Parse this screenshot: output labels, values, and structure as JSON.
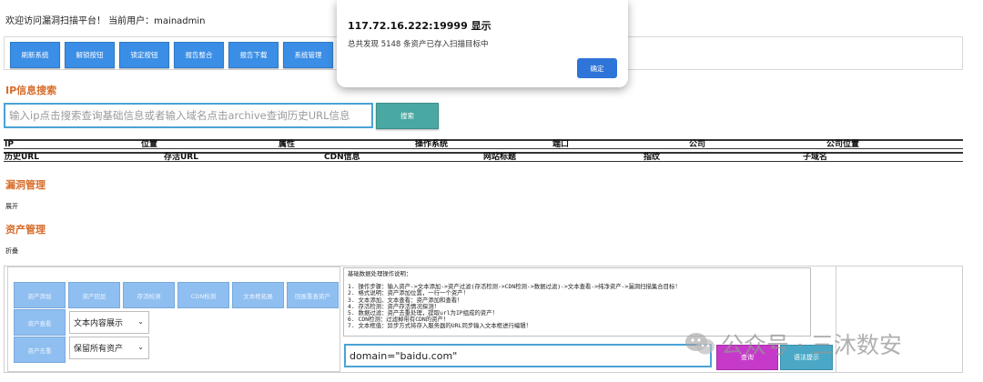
{
  "header": {
    "welcome": "欢迎访问漏洞扫描平台！ 当前用户：mainadmin"
  },
  "toolbar": {
    "buttons": [
      "刷新系统",
      "解锁按钮",
      "锁定按钮",
      "报告整合",
      "报告下载",
      "系统管理"
    ]
  },
  "ip_search": {
    "title": "IP信息搜索",
    "placeholder": "输入ip点击搜索查询基础信息或者输入域名点击archive查询历史URL信息",
    "button": "搜索"
  },
  "table": {
    "row1": [
      "IP",
      "位置",
      "属性",
      "操作系统",
      "端口",
      "公司",
      "公司位置"
    ],
    "row2": [
      "历史URL",
      "存活URL",
      "CDN信息",
      "网站标题",
      "指纹",
      "子域名"
    ]
  },
  "vuln": {
    "title": "漏洞管理",
    "toggle": "展开"
  },
  "asset": {
    "title": "资产管理",
    "toggle": "折叠",
    "buttons_row1": [
      "资产添加",
      "资产回显",
      "存活检测",
      "CDN检测",
      "文本框拓展",
      "回报重查资产"
    ],
    "view_label": "资产查看",
    "view_select": "文本内容展示",
    "dedup_label": "资产去重",
    "dedup_select": "保留所有资产",
    "desc_title": "基础数据处理操作说明：",
    "desc_lines": [
      "1. 操作步骤：输入资产->文本添加->资产过滤(存活检测->CDN检测->数据过滤)->文本查看->纯净资产->漏洞扫描集合目标！",
      "2. 格式说明：资产添加位置，一行一个资产！",
      "3. 文本添加、文本查看：资产添加和查看！",
      "4. 存活检测：资产存活情况探测！",
      "5. 数据过滤：资产去重处理，提取url为IP组成的资产！",
      "6. CDN检测：过滤掉带有CDN的资产！",
      "7. 文本框值：异步方式将存入服务器的URL同步输入文本框进行编辑！"
    ],
    "domain_value": "domain=\"baidu.com\"",
    "query_button": "查询",
    "syntax_button": "语法提示"
  },
  "dialog": {
    "title": "117.72.16.222:19999 显示",
    "message": "总共发现 5148 条资产已存入扫描目标中",
    "ok": "确定"
  },
  "watermark": {
    "text": "公众号 · 三沐数安"
  }
}
